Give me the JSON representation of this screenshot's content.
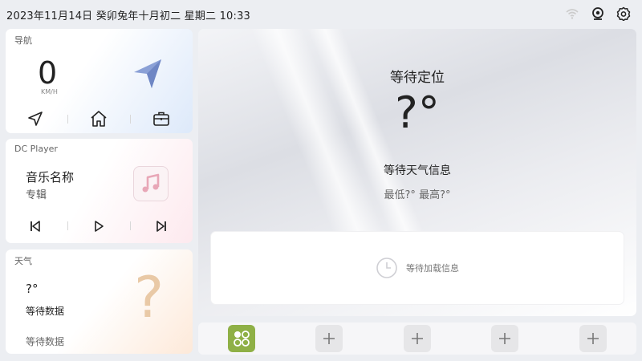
{
  "status_bar": {
    "datetime": "2023年11月14日  癸卯兔年十月初二  星期二  10:33",
    "icons": [
      "wifi-icon",
      "camera-icon",
      "settings-icon"
    ]
  },
  "nav_card": {
    "title": "导航",
    "speed": "0",
    "unit": "KM/H",
    "buttons": [
      "navigate-icon",
      "home-icon",
      "briefcase-icon"
    ]
  },
  "player_card": {
    "title": "DC Player",
    "song": "音乐名称",
    "album": "专辑",
    "controls": [
      "previous-icon",
      "play-icon",
      "next-icon"
    ]
  },
  "weather_card": {
    "title": "天气",
    "temp": "?°",
    "status": "等待数据",
    "status2": "等待数据"
  },
  "main_weather": {
    "location": "等待定位",
    "temp": "?°",
    "info": "等待天气信息",
    "minmax": "最低?° 最高?°",
    "loading": "等待加载信息"
  },
  "dock": {
    "slots": [
      "apps-icon",
      "add-icon",
      "add-icon",
      "add-icon",
      "add-icon"
    ]
  },
  "colors": {
    "accent_green": "#8fb046",
    "nav_arrow": "#8aa0d6"
  }
}
